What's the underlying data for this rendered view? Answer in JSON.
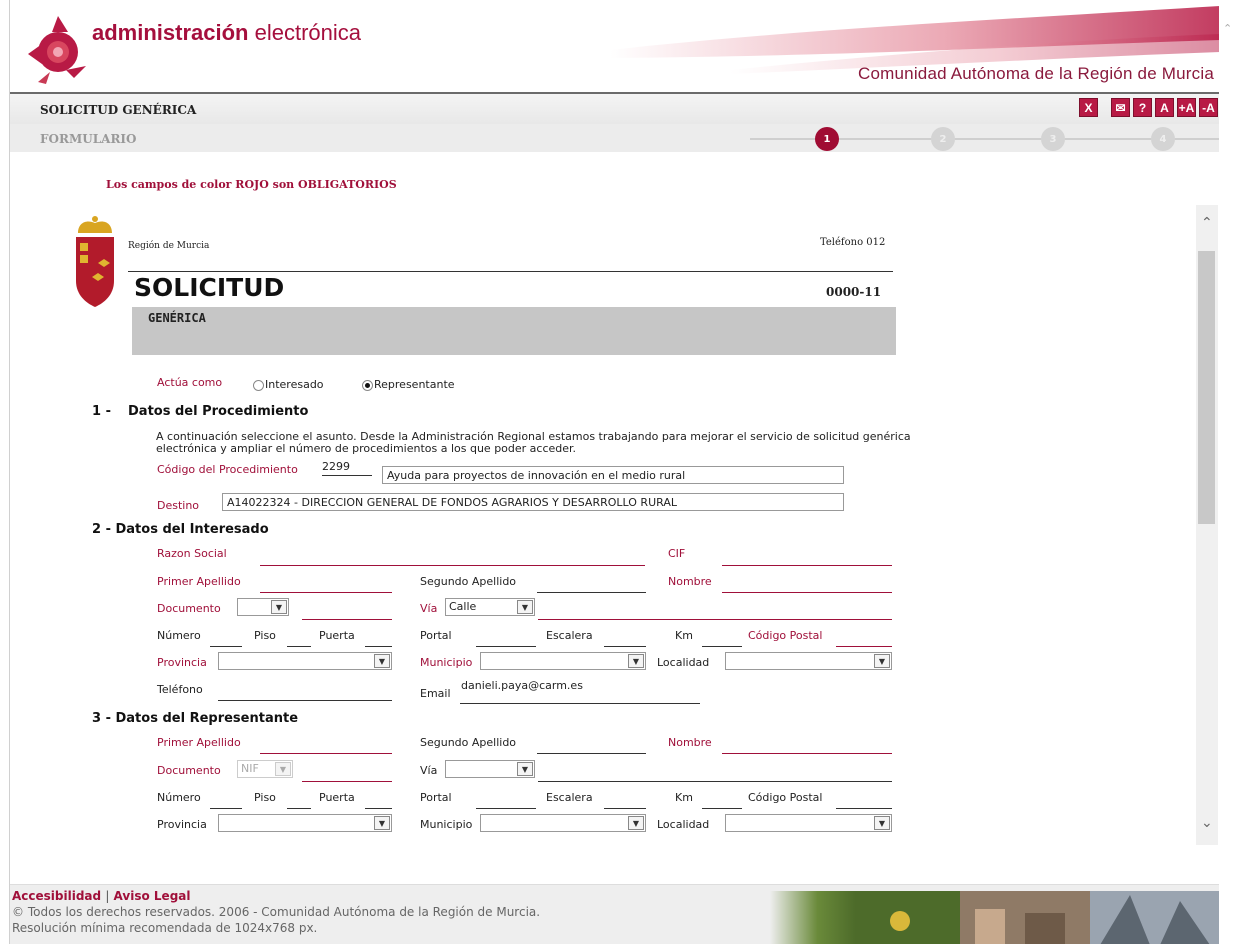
{
  "header": {
    "brand_bold": "administración",
    "brand_light": " electrónica",
    "region": "Comunidad Autónoma de la Región de Murcia",
    "page_title": "SOLICITUD GENÉRICA",
    "form_label": "FORMULARIO",
    "toolbar": [
      "X",
      "✉",
      "?",
      "A",
      "+A",
      "-A"
    ],
    "steps": [
      "1",
      "2",
      "3",
      "4"
    ],
    "active_step": 1,
    "accent_color": "#a0103a"
  },
  "required_note": "Los campos de color ROJO son OBLIGATORIOS",
  "doc": {
    "region_small": "Región de Murcia",
    "phone": "Teléfono 012",
    "title": "SOLICITUD",
    "code": "0000-11",
    "subtitle": "GENÉRICA"
  },
  "acting": {
    "label": "Actúa como",
    "options": [
      "Interesado",
      "Representante"
    ],
    "selected": "Representante"
  },
  "sec1": {
    "number": "1 -",
    "title": "Datos del Procedimiento",
    "description": "A continuación seleccione el asunto. Desde la Administración Regional estamos trabajando para mejorar el servicio de solicitud genérica electrónica y ampliar el número de procedimientos a los que poder acceder.",
    "codigo_label": "Código del Procedimiento",
    "codigo_value": "2299",
    "procedure_name": "Ayuda para proyectos de innovación en el medio rural",
    "destino_label": "Destino",
    "destino_value": "A14022324 -    DIRECCION GENERAL DE FONDOS AGRARIOS Y DESARROLLO RURAL"
  },
  "sec2": {
    "title": "2 - Datos del Interesado",
    "labels": {
      "razon_social": "Razon Social",
      "cif": "CIF",
      "primer_apellido": "Primer Apellido",
      "segundo_apellido": "Segundo Apellido",
      "nombre": "Nombre",
      "documento": "Documento",
      "via": "Vía",
      "numero": "Número",
      "piso": "Piso",
      "puerta": "Puerta",
      "portal": "Portal",
      "escalera": "Escalera",
      "km": "Km",
      "codigo_postal": "Código Postal",
      "provincia": "Provincia",
      "municipio": "Municipio",
      "localidad": "Localidad",
      "telefono": "Teléfono",
      "email": "Email"
    },
    "via_value": "Calle",
    "email_value": "danieli.paya@carm.es"
  },
  "sec3": {
    "title": "3 - Datos del Representante",
    "labels": {
      "primer_apellido": "Primer Apellido",
      "segundo_apellido": "Segundo Apellido",
      "nombre": "Nombre",
      "documento": "Documento",
      "via": "Vía",
      "numero": "Número",
      "piso": "Piso",
      "puerta": "Puerta",
      "portal": "Portal",
      "escalera": "Escalera",
      "km": "Km",
      "codigo_postal": "Código Postal",
      "provincia": "Provincia",
      "municipio": "Municipio",
      "localidad": "Localidad"
    },
    "documento_value": "NIF"
  },
  "footer": {
    "accesibilidad": "Accesibilidad",
    "separator": "|",
    "aviso_legal": "Aviso Legal",
    "copyright": "© Todos los derechos reservados. 2006 - Comunidad Autónoma de la Región de Murcia.",
    "resolution": "Resolución mínima recomendada de 1024x768 px."
  }
}
